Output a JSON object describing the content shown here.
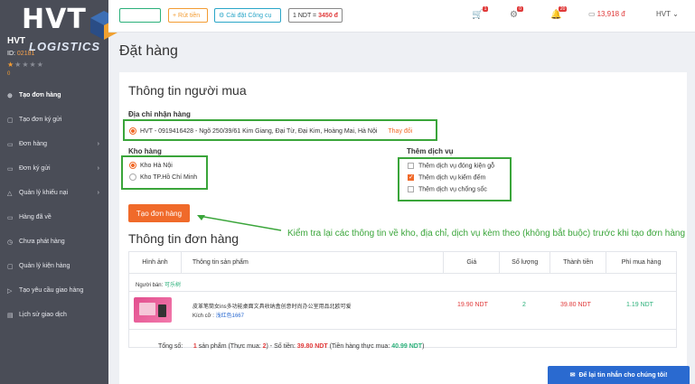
{
  "brand": {
    "name": "HVT",
    "sub": "LOGISTICS"
  },
  "user": {
    "name": "HVT",
    "id_label": "ID:",
    "id_value": "02181",
    "level": "0"
  },
  "sidebar": {
    "collapse_icon": "chevron-left-icon",
    "items": [
      {
        "label": "Tạo đơn hàng",
        "icon": "plus-circle-icon"
      },
      {
        "label": "Tạo đơn ký gửi",
        "icon": "file-icon"
      },
      {
        "label": "Đơn hàng",
        "icon": "list-icon"
      },
      {
        "label": "Đơn ký gửi",
        "icon": "box-icon"
      },
      {
        "label": "Quản lý khiếu nại",
        "icon": "warning-icon"
      },
      {
        "label": "Hàng đã về",
        "icon": "truck-icon"
      },
      {
        "label": "Chưa phát hàng",
        "icon": "clock-icon"
      },
      {
        "label": "Quản lý kiện hàng",
        "icon": "package-icon"
      },
      {
        "label": "Tạo yêu cầu giao hàng",
        "icon": "send-icon"
      },
      {
        "label": "Lịch sử giao dịch",
        "icon": "history-icon"
      }
    ]
  },
  "topbar": {
    "rut_tien": "+ Rút tiền",
    "cai_dat": "⚙ Cài đặt Công cụ",
    "rate_prefix": "1 NDT =",
    "rate_value": "3450 đ",
    "cart_badge": "1",
    "notif_badge": "0",
    "bell_badge": "20",
    "wallet": "13,918 đ",
    "user": "HVT ⌄"
  },
  "page": {
    "title": "Đặt hàng"
  },
  "buyer": {
    "heading": "Thông tin người mua",
    "address_label": "Địa chỉ nhận hàng",
    "address": "HVT - 0919416428 - Ngõ 250/39/61 Kim Giang, Đại Từ, Đại Kim, Hoàng Mai, Hà Nội",
    "change": "Thay đổi",
    "warehouse_label": "Kho hàng",
    "warehouses": [
      "Kho Hà Nội",
      "Kho TP.Hồ Chí Minh"
    ],
    "services_label": "Thêm dịch vụ",
    "services": [
      "Thêm dịch vụ đóng kiện gỗ",
      "Thêm dịch vụ kiểm đếm",
      "Thêm dịch vụ chống sốc"
    ]
  },
  "order_button": "Tạo đơn hàng",
  "annotation": "Kiểm tra lại các thông tin về kho, địa chỉ, dịch vụ kèm theo (không bắt buộc) trước khi tạo đơn hàng",
  "order": {
    "heading": "Thông tin đơn hàng",
    "columns": [
      "Hình ảnh",
      "Thông tin sản phẩm",
      "Giá",
      "Số lượng",
      "Thành tiền",
      "Phí mua hàng"
    ],
    "seller_label": "Người bán:",
    "seller": "可乐树",
    "product_name": "皮革笔筒女ins多功能桌面文具收纳盒创意时尚办公室用品北欧可爱",
    "size_label": "Kích cỡ :",
    "size_value": "浅红色1667",
    "price": "19.90 NDT",
    "qty": "2",
    "total": "39.80 NDT",
    "fee": "1.19 NDT",
    "summary_label": "Tổng số:",
    "summary_count": "1",
    "summary_mid1": "sản phẩm (Thực mua:",
    "summary_real": "2",
    "summary_mid2": ") - Số tiền:",
    "summary_amount": "39.80 NDT",
    "summary_mid3": "(Tiền hàng thực mua:",
    "summary_real_amount": "40.99 NDT",
    "summary_end": ")"
  },
  "chat": "Để lại tin nhắn cho chúng tôi!"
}
